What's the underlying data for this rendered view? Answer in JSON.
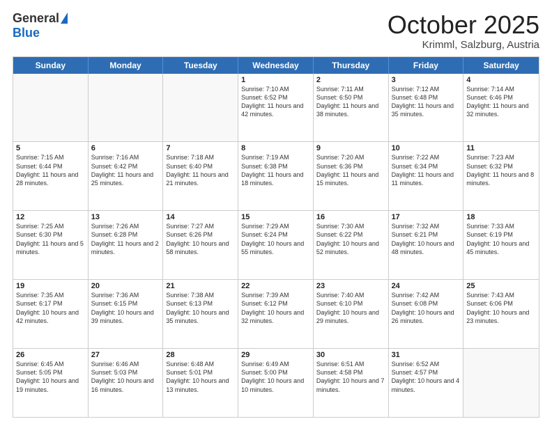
{
  "header": {
    "logo_general": "General",
    "logo_blue": "Blue",
    "title": "October 2025",
    "location": "Krimml, Salzburg, Austria"
  },
  "days_of_week": [
    "Sunday",
    "Monday",
    "Tuesday",
    "Wednesday",
    "Thursday",
    "Friday",
    "Saturday"
  ],
  "weeks": [
    [
      {
        "day": "",
        "info": ""
      },
      {
        "day": "",
        "info": ""
      },
      {
        "day": "",
        "info": ""
      },
      {
        "day": "1",
        "info": "Sunrise: 7:10 AM\nSunset: 6:52 PM\nDaylight: 11 hours and 42 minutes."
      },
      {
        "day": "2",
        "info": "Sunrise: 7:11 AM\nSunset: 6:50 PM\nDaylight: 11 hours and 38 minutes."
      },
      {
        "day": "3",
        "info": "Sunrise: 7:12 AM\nSunset: 6:48 PM\nDaylight: 11 hours and 35 minutes."
      },
      {
        "day": "4",
        "info": "Sunrise: 7:14 AM\nSunset: 6:46 PM\nDaylight: 11 hours and 32 minutes."
      }
    ],
    [
      {
        "day": "5",
        "info": "Sunrise: 7:15 AM\nSunset: 6:44 PM\nDaylight: 11 hours and 28 minutes."
      },
      {
        "day": "6",
        "info": "Sunrise: 7:16 AM\nSunset: 6:42 PM\nDaylight: 11 hours and 25 minutes."
      },
      {
        "day": "7",
        "info": "Sunrise: 7:18 AM\nSunset: 6:40 PM\nDaylight: 11 hours and 21 minutes."
      },
      {
        "day": "8",
        "info": "Sunrise: 7:19 AM\nSunset: 6:38 PM\nDaylight: 11 hours and 18 minutes."
      },
      {
        "day": "9",
        "info": "Sunrise: 7:20 AM\nSunset: 6:36 PM\nDaylight: 11 hours and 15 minutes."
      },
      {
        "day": "10",
        "info": "Sunrise: 7:22 AM\nSunset: 6:34 PM\nDaylight: 11 hours and 11 minutes."
      },
      {
        "day": "11",
        "info": "Sunrise: 7:23 AM\nSunset: 6:32 PM\nDaylight: 11 hours and 8 minutes."
      }
    ],
    [
      {
        "day": "12",
        "info": "Sunrise: 7:25 AM\nSunset: 6:30 PM\nDaylight: 11 hours and 5 minutes."
      },
      {
        "day": "13",
        "info": "Sunrise: 7:26 AM\nSunset: 6:28 PM\nDaylight: 11 hours and 2 minutes."
      },
      {
        "day": "14",
        "info": "Sunrise: 7:27 AM\nSunset: 6:26 PM\nDaylight: 10 hours and 58 minutes."
      },
      {
        "day": "15",
        "info": "Sunrise: 7:29 AM\nSunset: 6:24 PM\nDaylight: 10 hours and 55 minutes."
      },
      {
        "day": "16",
        "info": "Sunrise: 7:30 AM\nSunset: 6:22 PM\nDaylight: 10 hours and 52 minutes."
      },
      {
        "day": "17",
        "info": "Sunrise: 7:32 AM\nSunset: 6:21 PM\nDaylight: 10 hours and 48 minutes."
      },
      {
        "day": "18",
        "info": "Sunrise: 7:33 AM\nSunset: 6:19 PM\nDaylight: 10 hours and 45 minutes."
      }
    ],
    [
      {
        "day": "19",
        "info": "Sunrise: 7:35 AM\nSunset: 6:17 PM\nDaylight: 10 hours and 42 minutes."
      },
      {
        "day": "20",
        "info": "Sunrise: 7:36 AM\nSunset: 6:15 PM\nDaylight: 10 hours and 39 minutes."
      },
      {
        "day": "21",
        "info": "Sunrise: 7:38 AM\nSunset: 6:13 PM\nDaylight: 10 hours and 35 minutes."
      },
      {
        "day": "22",
        "info": "Sunrise: 7:39 AM\nSunset: 6:12 PM\nDaylight: 10 hours and 32 minutes."
      },
      {
        "day": "23",
        "info": "Sunrise: 7:40 AM\nSunset: 6:10 PM\nDaylight: 10 hours and 29 minutes."
      },
      {
        "day": "24",
        "info": "Sunrise: 7:42 AM\nSunset: 6:08 PM\nDaylight: 10 hours and 26 minutes."
      },
      {
        "day": "25",
        "info": "Sunrise: 7:43 AM\nSunset: 6:06 PM\nDaylight: 10 hours and 23 minutes."
      }
    ],
    [
      {
        "day": "26",
        "info": "Sunrise: 6:45 AM\nSunset: 5:05 PM\nDaylight: 10 hours and 19 minutes."
      },
      {
        "day": "27",
        "info": "Sunrise: 6:46 AM\nSunset: 5:03 PM\nDaylight: 10 hours and 16 minutes."
      },
      {
        "day": "28",
        "info": "Sunrise: 6:48 AM\nSunset: 5:01 PM\nDaylight: 10 hours and 13 minutes."
      },
      {
        "day": "29",
        "info": "Sunrise: 6:49 AM\nSunset: 5:00 PM\nDaylight: 10 hours and 10 minutes."
      },
      {
        "day": "30",
        "info": "Sunrise: 6:51 AM\nSunset: 4:58 PM\nDaylight: 10 hours and 7 minutes."
      },
      {
        "day": "31",
        "info": "Sunrise: 6:52 AM\nSunset: 4:57 PM\nDaylight: 10 hours and 4 minutes."
      },
      {
        "day": "",
        "info": ""
      }
    ]
  ]
}
